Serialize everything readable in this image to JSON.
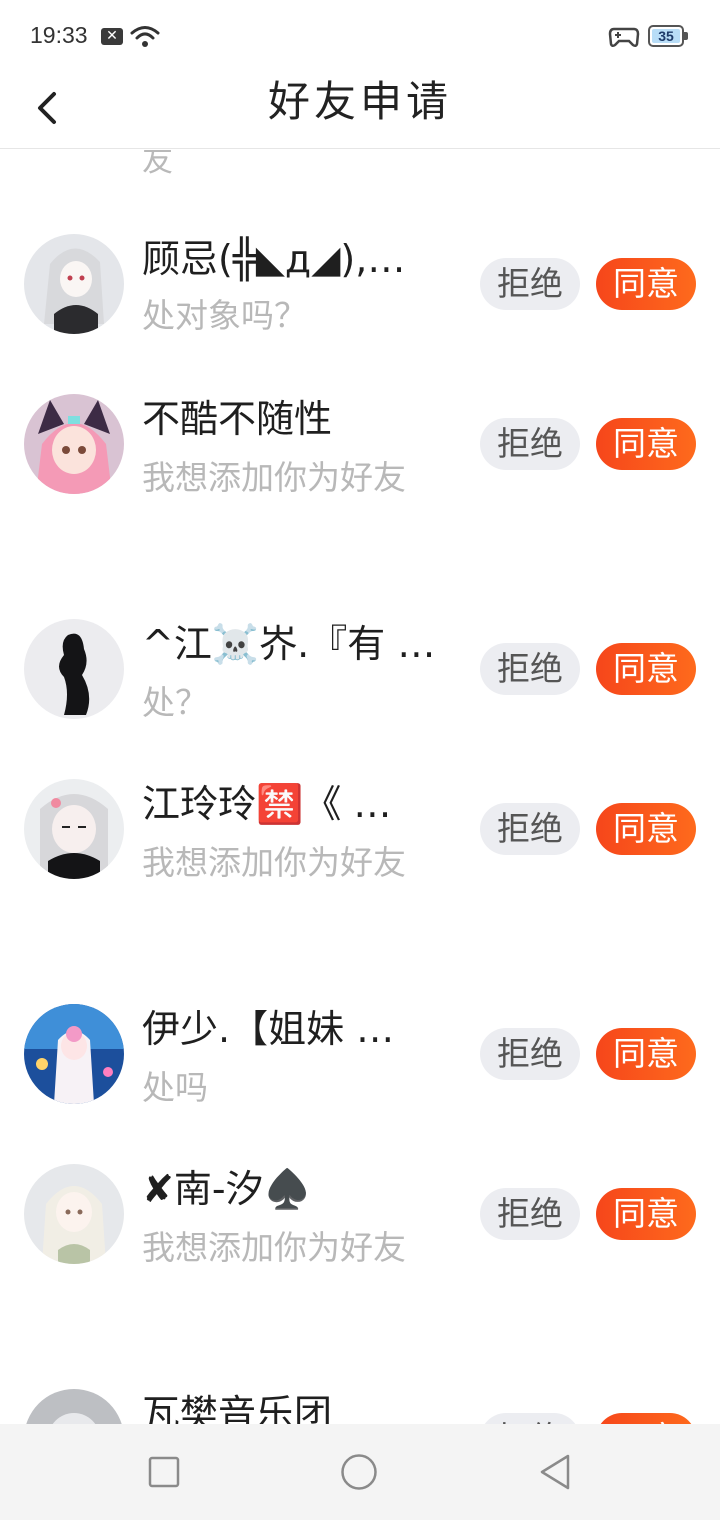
{
  "status_bar": {
    "time": "19:33",
    "notification_icon": "x-box-icon",
    "battery_level": "35"
  },
  "header": {
    "title": "好友申请",
    "back_icon": "chevron-left-icon"
  },
  "partial_top_text": "友",
  "buttons": {
    "reject_label": "拒绝",
    "accept_label": "同意"
  },
  "requests": [
    {
      "name": "顾忌(╬◣д◢),…",
      "message": "处对象吗？"
    },
    {
      "name": "不酷不随性",
      "message": "我想添加你为好友"
    },
    {
      "name": "^江☠️岕.『有 …",
      "message": "处？"
    },
    {
      "name": "江玲玲🈲《 …",
      "message": "我想添加你为好友"
    },
    {
      "name": "伊少.【姐妹 …",
      "message": "处吗"
    },
    {
      "name": "✘南-汐♠️",
      "message": "我想添加你为好友"
    },
    {
      "name": "瓦樊音乐团",
      "message": ""
    }
  ],
  "colors": {
    "accept_gradient_start": "#f6461b",
    "accept_gradient_end": "#fe6a1c",
    "reject_bg": "#ecedf1",
    "message_text": "#b8b8b8"
  }
}
